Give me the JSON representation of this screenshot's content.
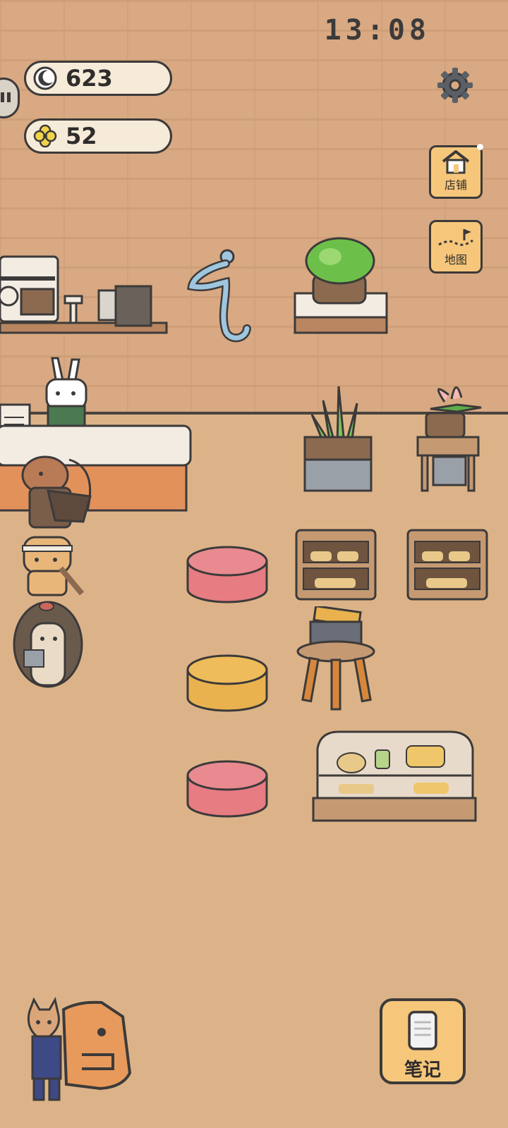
{
  "status": {
    "time": "13:08"
  },
  "currency": {
    "moon": {
      "icon": "moon-icon",
      "value": "623"
    },
    "clover": {
      "icon": "clover-icon",
      "value": "52"
    }
  },
  "menu": {
    "settings_icon": "gear-icon",
    "shop_label": "店铺",
    "map_label": "地图",
    "notes_label": "笔记"
  },
  "colors": {
    "wall": "#d8a982",
    "floor": "#dcb388",
    "button": "#f6c77b",
    "pill": "#f6ebd8",
    "outline": "#3c3a3a"
  }
}
